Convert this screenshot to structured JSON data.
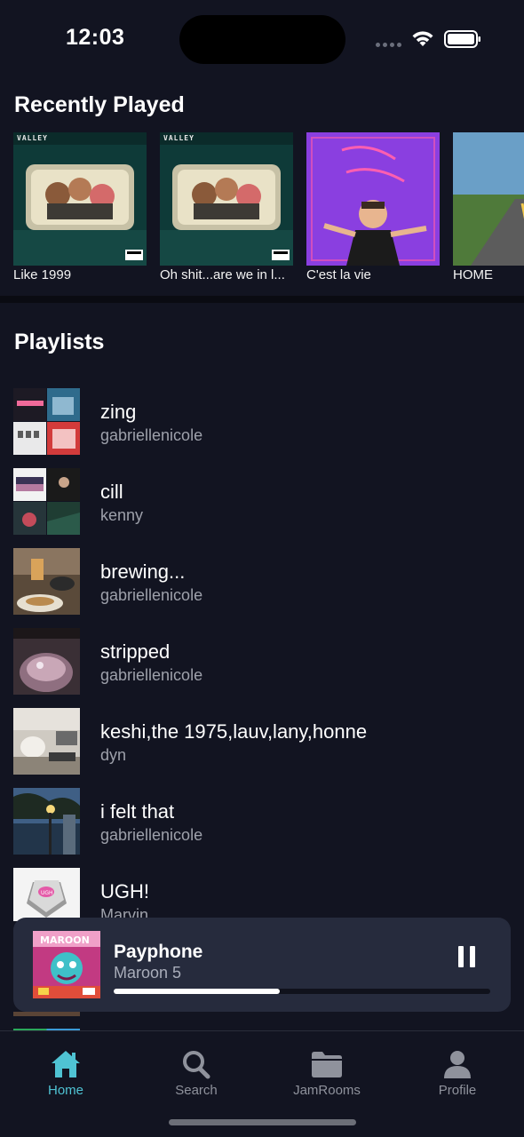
{
  "status": {
    "time": "12:03"
  },
  "recently_played": {
    "title": "Recently Played",
    "items": [
      {
        "label": "Like 1999",
        "cover_text": "VALLEY"
      },
      {
        "label": "Oh shit...are we in l...",
        "cover_text": "VALLEY"
      },
      {
        "label": "C'est la vie",
        "cover_text": ""
      },
      {
        "label": "HOME",
        "cover_text": ""
      }
    ]
  },
  "playlists": {
    "title": "Playlists",
    "items": [
      {
        "name": "zing",
        "owner": "gabriellenicole"
      },
      {
        "name": "cill",
        "owner": "kenny"
      },
      {
        "name": "brewing...",
        "owner": "gabriellenicole"
      },
      {
        "name": "stripped",
        "owner": "gabriellenicole"
      },
      {
        "name": "keshi,the 1975,lauv,lany,honne",
        "owner": "dyn"
      },
      {
        "name": "i felt that",
        "owner": "gabriellenicole"
      },
      {
        "name": "UGH!",
        "owner": "Marvin"
      }
    ]
  },
  "now_playing": {
    "title": "Payphone",
    "artist": "Maroon 5",
    "progress": 0.44,
    "state": "playing"
  },
  "tabs": [
    {
      "label": "Home",
      "icon": "home-icon",
      "active": true
    },
    {
      "label": "Search",
      "icon": "search-icon",
      "active": false
    },
    {
      "label": "JamRooms",
      "icon": "folder-icon",
      "active": false
    },
    {
      "label": "Profile",
      "icon": "profile-icon",
      "active": false
    }
  ],
  "colors": {
    "background": "#121421",
    "accent": "#4fc3d3",
    "player": "#262b3d"
  }
}
